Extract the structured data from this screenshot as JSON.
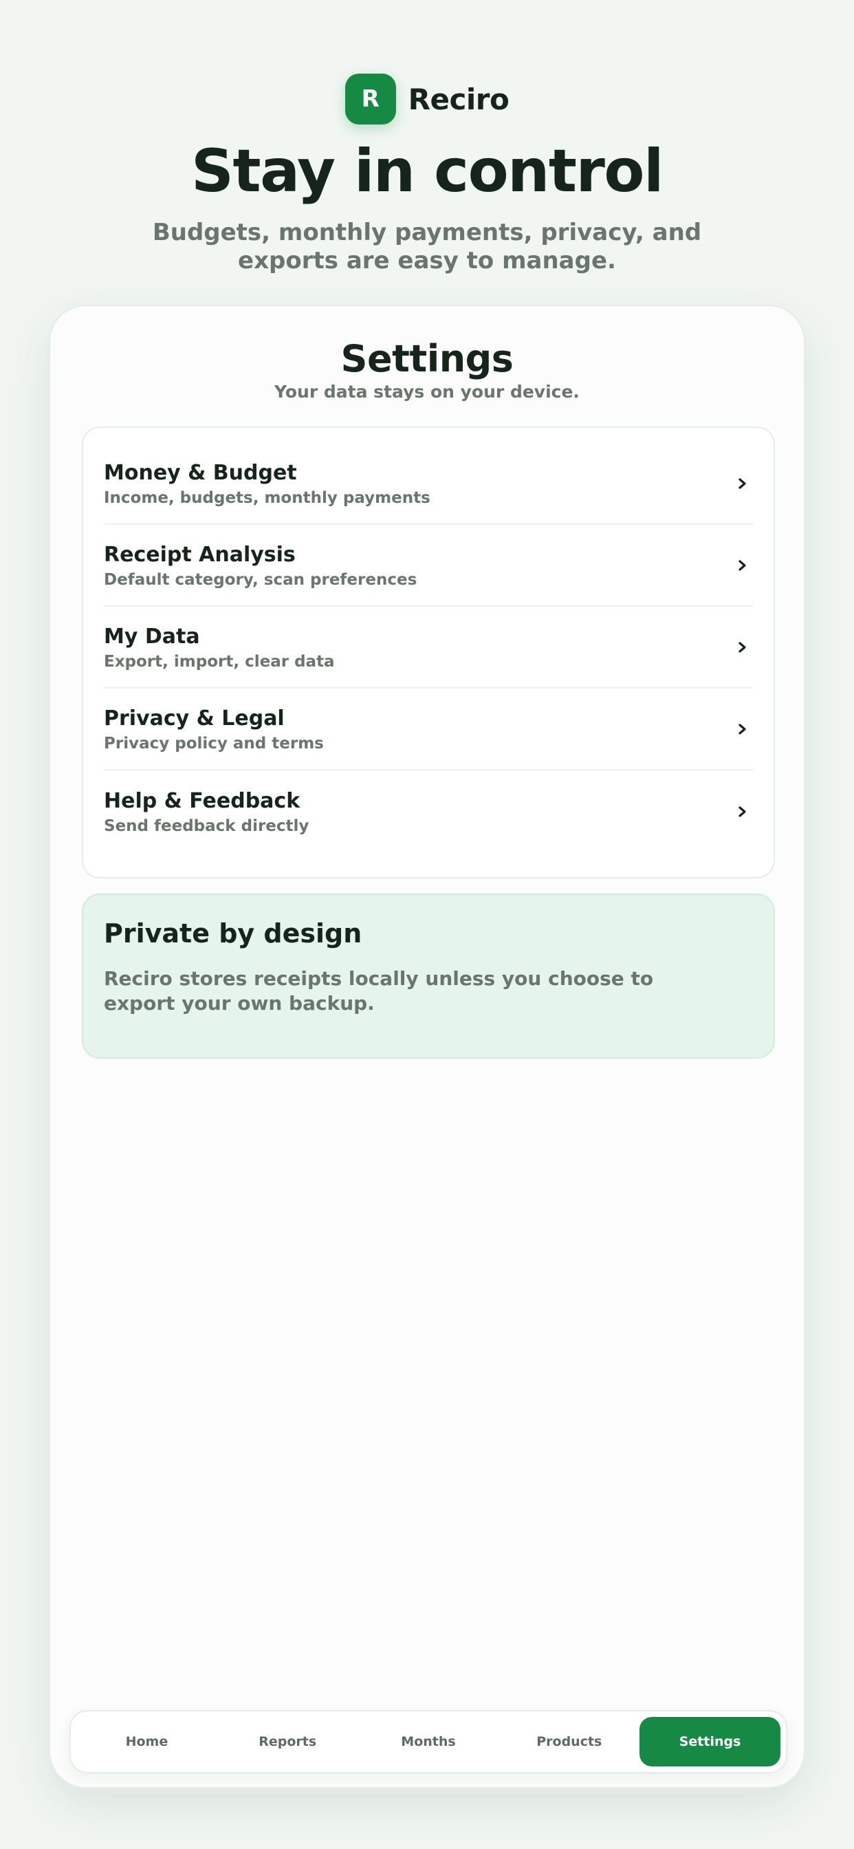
{
  "brand": {
    "logo_letter": "R",
    "name": "Reciro"
  },
  "hero": {
    "title": "Stay in control",
    "subtitle": "Budgets, monthly payments, privacy, and exports are easy to manage."
  },
  "settings": {
    "title": "Settings",
    "subtitle": "Your data stays on your device.",
    "items": [
      {
        "title": "Money & Budget",
        "description": "Income, budgets, monthly payments"
      },
      {
        "title": "Receipt Analysis",
        "description": "Default category, scan preferences"
      },
      {
        "title": "My Data",
        "description": "Export, import, clear data"
      },
      {
        "title": "Privacy & Legal",
        "description": "Privacy policy and terms"
      },
      {
        "title": "Help & Feedback",
        "description": "Send feedback directly"
      }
    ]
  },
  "private_box": {
    "title": "Private by design",
    "text": "Reciro stores receipts locally unless you choose to export your own backup."
  },
  "nav": {
    "items": [
      {
        "label": "Home"
      },
      {
        "label": "Reports"
      },
      {
        "label": "Months"
      },
      {
        "label": "Products"
      },
      {
        "label": "Settings"
      }
    ],
    "active": "Settings"
  },
  "colors": {
    "accent": "#168a45",
    "private_bg": "#e5f5ec",
    "text": "#16241b",
    "muted": "#6a756e"
  },
  "icons": {
    "row_chevron": "chevron-right-icon"
  }
}
